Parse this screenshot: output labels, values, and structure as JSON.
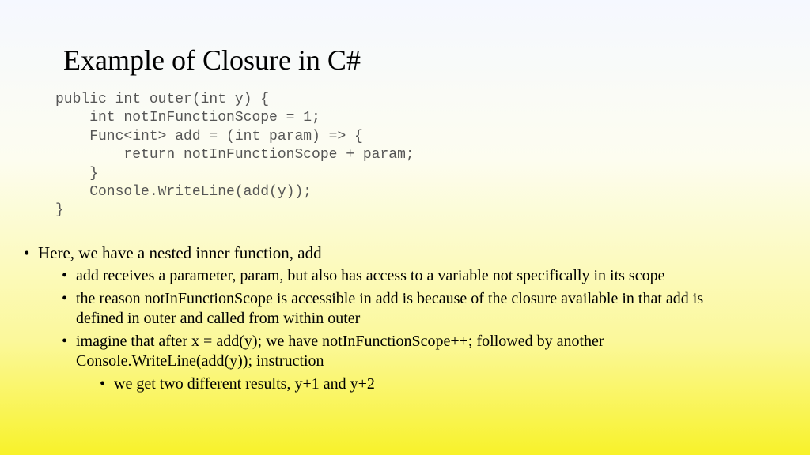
{
  "title": "Example of Closure in C#",
  "code": "public int outer(int y) {\n    int notInFunctionScope = 1;\n    Func<int> add = (int param) => {\n        return notInFunctionScope + param;\n    }\n    Console.WriteLine(add(y));\n}",
  "bullets": {
    "b1": "Here, we have a nested inner function, add",
    "b2a": "add receives a parameter, param, but also has access to a variable not specifically in its scope",
    "b2b": "the reason notInFunctionScope is accessible in add is because of the closure available in that add is defined in outer and called from within outer",
    "b2c": "imagine that after x = add(y); we have notInFunctionScope++; followed by another Console.WriteLine(add(y)); instruction",
    "b3a": "we get two different results, y+1 and y+2"
  }
}
